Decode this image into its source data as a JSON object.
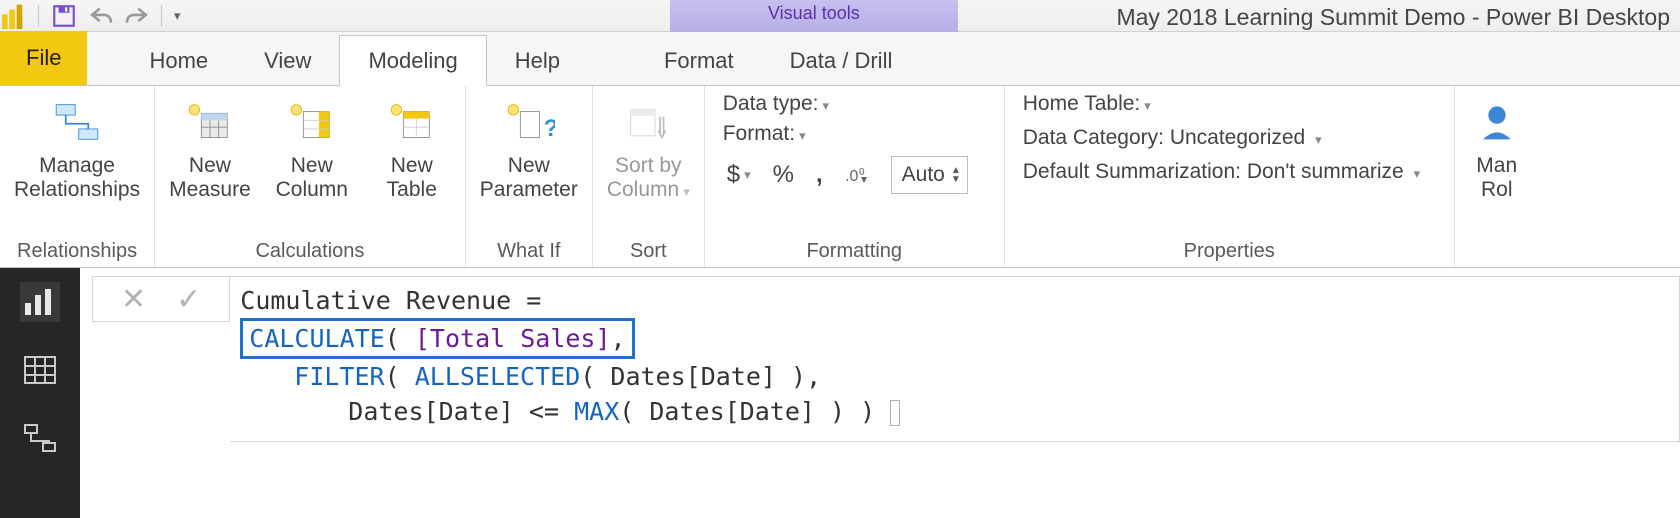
{
  "titlebar": {
    "contextual_label": "Visual tools",
    "window_title": "May 2018 Learning Summit Demo - Power BI Desktop"
  },
  "tabs": {
    "file": "File",
    "items": [
      {
        "label": "Home"
      },
      {
        "label": "View"
      },
      {
        "label": "Modeling"
      },
      {
        "label": "Help"
      },
      {
        "label": "Format"
      },
      {
        "label": "Data / Drill"
      }
    ],
    "active_index": 2
  },
  "ribbon": {
    "groups": {
      "relationships": {
        "label": "Relationships",
        "manage": "Manage\nRelationships"
      },
      "calculations": {
        "label": "Calculations",
        "new_measure": "New\nMeasure",
        "new_column": "New\nColumn",
        "new_table": "New\nTable"
      },
      "whatif": {
        "label": "What If",
        "new_parameter": "New\nParameter"
      },
      "sort": {
        "label": "Sort",
        "sort_by_column": "Sort by\nColumn"
      },
      "formatting": {
        "label": "Formatting",
        "data_type": "Data type:",
        "format": "Format:",
        "auto": "Auto"
      },
      "properties": {
        "label": "Properties",
        "home_table": "Home Table:",
        "data_category_label": "Data Category:",
        "data_category_value": "Uncategorized",
        "default_sum_label": "Default Summarization:",
        "default_sum_value": "Don't summarize"
      },
      "security": {
        "manage_roles": "Man\nRol"
      }
    }
  },
  "formula": {
    "measure_name": "Cumulative Revenue",
    "line1_func": "CALCULATE",
    "line1_ref": "[Total Sales]",
    "line2_filter": "FILTER",
    "line2_allsel": "ALLSELECTED",
    "line2_col": "Dates[Date]",
    "line3_col": "Dates[Date]",
    "line3_op": "<=",
    "line3_max": "MAX",
    "line3_col2": "Dates[Date]"
  }
}
